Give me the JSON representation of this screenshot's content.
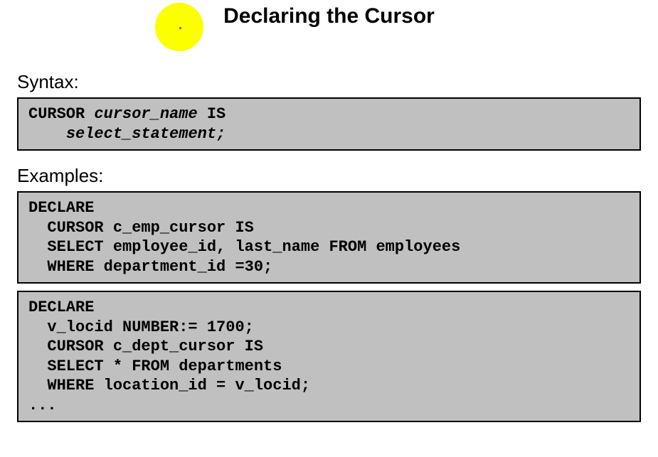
{
  "title": "Declaring the Cursor",
  "sections": {
    "syntax_label": "Syntax:",
    "examples_label": "Examples:"
  },
  "syntax_box": {
    "kw1": "CURSOR ",
    "ph1": "cursor_name",
    "kw2": " IS",
    "indent": "    ",
    "ph2": "select_statement;"
  },
  "example1": {
    "l1": "DECLARE",
    "l2": "  CURSOR c_emp_cursor IS",
    "l3": "  SELECT employee_id, last_name FROM employees",
    "l4": "  WHERE department_id =30;"
  },
  "example2": {
    "l1": "DECLARE",
    "l2": "  v_locid NUMBER:= 1700;",
    "l3": "  CURSOR c_dept_cursor IS",
    "l4": "  SELECT * FROM departments",
    "l5": "  WHERE location_id = v_locid;",
    "l6": "..."
  }
}
